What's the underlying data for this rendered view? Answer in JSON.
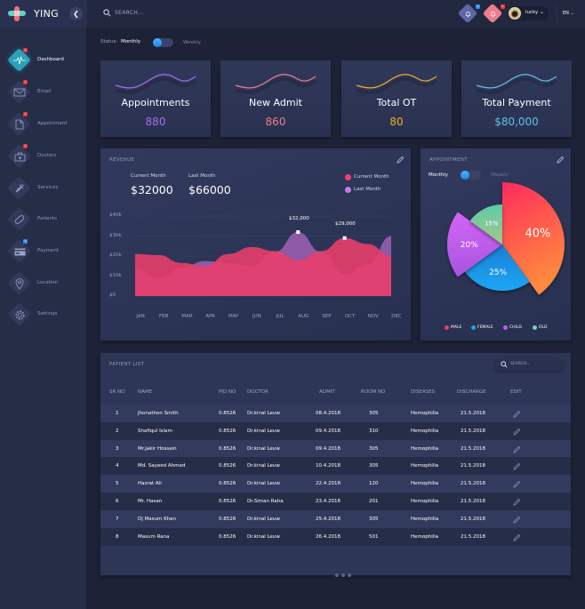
{
  "app": {
    "brand": "YING",
    "search_placeholder": "SEARCH...",
    "notifications": [
      {
        "icon": "bell-icon",
        "count": "2",
        "color": "#5e66a8",
        "badge_color": "#2f8ff0"
      },
      {
        "icon": "bell-icon",
        "count": "1",
        "color": "#f07d8c",
        "badge_color": "#e8373e"
      }
    ],
    "user": {
      "name": "lucky"
    },
    "language": "EN"
  },
  "sidebar": {
    "items": [
      {
        "label": "Dashboard",
        "icon": "pulse-icon",
        "badge": "2",
        "active": true
      },
      {
        "label": "Email",
        "icon": "envelope-icon",
        "badge": "1"
      },
      {
        "label": "Appoinment",
        "icon": "document-icon",
        "badge": "1"
      },
      {
        "label": "Doctors",
        "icon": "medical-kit-icon",
        "badge": "5"
      },
      {
        "label": "Services",
        "icon": "syringe-icon",
        "badge": ""
      },
      {
        "label": "Patients",
        "icon": "pill-icon",
        "badge": ""
      },
      {
        "label": "Payment",
        "icon": "credit-card-icon",
        "badge": "1",
        "badge_color": "blue"
      },
      {
        "label": "Location",
        "icon": "location-pin-icon",
        "badge": ""
      },
      {
        "label": "Settings",
        "icon": "gear-icon",
        "badge": ""
      }
    ]
  },
  "status": {
    "label": "Status:",
    "monthly": "Monthly",
    "weekly": "Weekly"
  },
  "stats": [
    {
      "title": "Appointments",
      "value": "880",
      "color": "#a86bf0"
    },
    {
      "title": "New  Admit",
      "value": "860",
      "color": "#f07d8c"
    },
    {
      "title": "Total OT",
      "value": "80",
      "color": "#f2ae1c"
    },
    {
      "title": "Total Payment",
      "value": "$80,000",
      "color": "#5cc2f2"
    }
  ],
  "revenue": {
    "title": "REVENUE",
    "current_label": "Current  Month",
    "current_value": "$32000",
    "last_label": "Last  Month",
    "last_value": "$66000",
    "legend": [
      {
        "label": "Current  Month",
        "color": "#f0416c"
      },
      {
        "label": "Last  Month",
        "color": "#c477f0"
      }
    ]
  },
  "chart_data": [
    {
      "type": "area",
      "title": "REVENUE",
      "categories": [
        "JAN",
        "FEB",
        "MAR",
        "APR",
        "MAY",
        "JUN",
        "JUL",
        "AUG",
        "SEP",
        "OCT",
        "NOV",
        "DEC"
      ],
      "yticks": [
        "$0",
        "$10k",
        "$20k",
        "$30k",
        "$40k"
      ],
      "ylim": [
        0,
        40000
      ],
      "series": [
        {
          "name": "Last  Month",
          "color": "#8e5aa8",
          "values": [
            14000,
            9000,
            14000,
            17500,
            16500,
            15000,
            22000,
            32000,
            22000,
            11000,
            16000,
            30000
          ]
        },
        {
          "name": "Current  Month",
          "color": "#e83e6c",
          "values": [
            21000,
            20500,
            16500,
            15000,
            21000,
            24500,
            22500,
            18000,
            22500,
            29000,
            26000,
            20000
          ]
        }
      ],
      "annotations": [
        {
          "label": "$32,000",
          "x": "AUG"
        },
        {
          "label": "$29,000",
          "x": "OCT"
        }
      ],
      "grid": true,
      "legend": "top-right"
    },
    {
      "type": "pie",
      "title": "APPOINTMENT",
      "slices": [
        {
          "label": "MALE",
          "value": 40,
          "text": "40%",
          "color_from": "#ff2b5e",
          "color_to": "#ff8a3d"
        },
        {
          "label": "FEMALE",
          "value": 25,
          "text": "25%",
          "color_from": "#1a7fd4",
          "color_to": "#1fa6f5"
        },
        {
          "label": "CHILD",
          "value": 20,
          "text": "20%",
          "color_from": "#d264f5",
          "color_to": "#a855e0"
        },
        {
          "label": "OLD",
          "value": 15,
          "text": "15%",
          "color_from": "#5ccba7",
          "color_to": "#a6c78a"
        }
      ],
      "legend": "bottom"
    }
  ],
  "appointment": {
    "title": "APPOINTMENT",
    "monthly": "Monthly",
    "weekly": "Weekly",
    "legend": [
      {
        "label": "MALE",
        "color": "#f0415a"
      },
      {
        "label": "FEMALE",
        "color": "#2a9df0"
      },
      {
        "label": "CHILD",
        "color": "#c35ef0"
      },
      {
        "label": "OLD",
        "color": "#6ed8b8"
      }
    ]
  },
  "patients": {
    "title": "PATIENT LIST",
    "search_placeholder": "SEARCH...",
    "columns": [
      "SR NO",
      "NAME",
      "PID NO",
      "DOCTOR",
      "ADMIT",
      "ROOM NO",
      "DISEASES",
      "DISCHARGE",
      "EDIT"
    ],
    "rows": [
      [
        "1",
        "Jhonathon  Smith",
        "0.8526",
        "Dr.kinal Leuw",
        "08.4.2018",
        "305",
        "Hemophilia",
        "21.5.2018"
      ],
      [
        "2",
        "Shafiqul  Islam",
        "0.8526",
        "Dr.kinal Leuw",
        "09.4.2018",
        "310",
        "Hemophilia",
        "21.5.2018"
      ],
      [
        "3",
        "Mr.Jakir  Hossain",
        "0.8526",
        "Dr.kinal Leuw",
        "09.4.2018",
        "305",
        "Hemophilia",
        "21.5.2018"
      ],
      [
        "4",
        "Md. Sayeed Ahmed",
        "0.8526",
        "Dr.kinal Leuw",
        "10.4.2018",
        "305",
        "Hemophilia",
        "21.5.2018"
      ],
      [
        "5",
        "Hazrat Ali",
        "0.8526",
        "Dr.kinal Leuw",
        "22.4.2018",
        "120",
        "Hemophilia",
        "21.5.2018"
      ],
      [
        "6",
        "Mr. Hasan",
        "0.8526",
        "Dr.Siman Raha",
        "23.4.2018",
        "201",
        "Hemophilia",
        "21.5.2018"
      ],
      [
        "7",
        "Dj  Masum  Khan",
        "0.8526",
        "Dr.kinal Leuw",
        "25.4.2018",
        "305",
        "Hemophilia",
        "21.5.2018"
      ],
      [
        "8",
        "Masum  Rana",
        "0.8526",
        "Dr.kinal Leuw",
        "26.4.2018",
        "501",
        "Hemophilia",
        "21.5.2018"
      ]
    ]
  }
}
